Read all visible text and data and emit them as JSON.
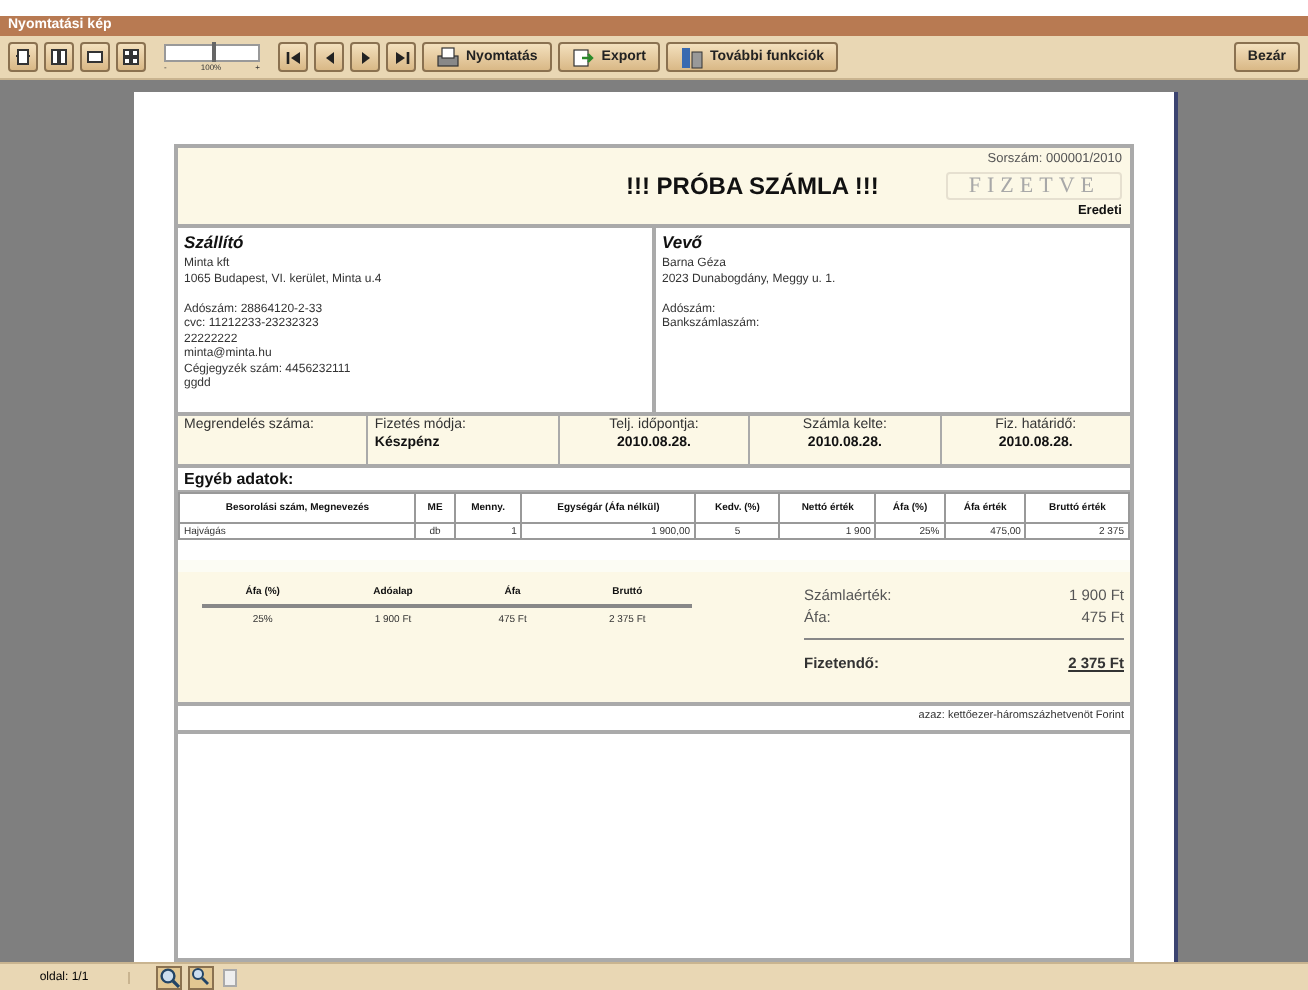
{
  "window": {
    "title": "Nyomtatási kép"
  },
  "toolbar": {
    "view_buttons": [
      {
        "kind": "single"
      },
      {
        "kind": "double"
      },
      {
        "kind": "wide"
      },
      {
        "kind": "multi"
      }
    ],
    "zoom": {
      "minus": "-",
      "reading": "100%",
      "plus": "+",
      "level": 0.5
    },
    "nav_buttons": [
      {
        "kind": "first"
      },
      {
        "kind": "prev"
      },
      {
        "kind": "next"
      },
      {
        "kind": "last"
      }
    ],
    "buttons": [
      {
        "kind": "print",
        "label": "Nyomtatás"
      },
      {
        "kind": "export",
        "label": "Export"
      },
      {
        "kind": "more",
        "label": "További funkciók"
      }
    ],
    "close": "Bezár"
  },
  "invoice": {
    "serial": "Sorszám: 000001/2010",
    "title": "!!! PRÓBA SZÁMLA !!!",
    "stamp": "FIZETVE",
    "copy": "Eredeti",
    "seller": {
      "heading": "Szállító",
      "line_groups": [
        [
          "Minta kft",
          "1065 Budapest, VI. kerület, Minta  u.4"
        ],
        [
          "Adószám: 28864120-2-33",
          "cvc: 11212233-23232323",
          "22222222",
          "minta@minta.hu",
          "Cégjegyzék szám: 4456232111",
          "ggdd"
        ]
      ]
    },
    "buyer": {
      "heading": "Vevő",
      "line_groups": [
        [
          "Barna Géza",
          "2023 Dunabogdány, Meggy u. 1."
        ],
        [
          "Adószám:",
          "Bankszámlaszám:"
        ]
      ]
    },
    "info": [
      {
        "label": "Megrendelés száma:"
      },
      {
        "label": "Fizetés módja:",
        "value": "Készpénz"
      },
      {
        "label": "Telj. időpontja:",
        "value": "2010.08.28."
      },
      {
        "label": "Számla kelte:",
        "value": "2010.08.28."
      },
      {
        "label": "Fiz. határidő:",
        "value": "2010.08.28."
      }
    ],
    "other_heading": "Egyéb adatok:",
    "columns": [
      "Besorolási szám, Megnevezés",
      "ME",
      "Menny.",
      "Egységár (Áfa nélkül)",
      "Kedv. (%)",
      "Nettó érték",
      "Áfa (%)",
      "Áfa érték",
      "Bruttó érték"
    ],
    "rows": [
      [
        "Hajvágás",
        "db",
        "1",
        "1 900,00",
        "5",
        "1 900",
        "25%",
        "475,00",
        "2 375"
      ]
    ],
    "vat_columns": [
      "Áfa (%)",
      "Adóalap",
      "Áfa",
      "Bruttó"
    ],
    "vat_rows": [
      [
        "25%",
        "1 900 Ft",
        "475 Ft",
        "2 375 Ft"
      ]
    ],
    "totals": [
      {
        "label": "Számlaérték:",
        "value": "1 900 Ft"
      },
      {
        "label": "Áfa:",
        "value": "475 Ft"
      }
    ],
    "payable": {
      "label": "Fizetendő:",
      "value": "2 375 Ft"
    },
    "in_words": "azaz: kettőezer-háromszázhetvenöt Forint"
  },
  "status_bar": {
    "page": "oldal: 1/1"
  }
}
